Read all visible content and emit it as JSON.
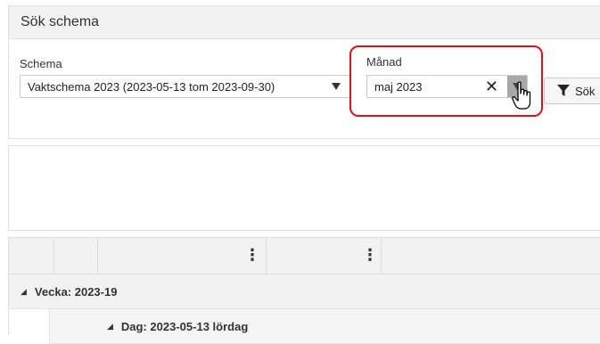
{
  "search_panel": {
    "title": "Sök schema",
    "schema": {
      "label": "Schema",
      "value": "Vaktschema 2023 (2023-05-13 tom 2023-09-30)"
    },
    "month": {
      "label": "Månad",
      "value": "maj 2023"
    },
    "filter_button": {
      "label": "Sök",
      "icon": "funnel-icon"
    }
  },
  "grid": {
    "column_menu_icon": "⋮",
    "groups": [
      {
        "label": "Vecka: 2023-19",
        "expanded": true,
        "level": 1
      },
      {
        "label": "Dag: 2023-05-13 lördag",
        "expanded": true,
        "level": 2
      }
    ]
  },
  "colors": {
    "highlight": "#d8141c",
    "header_bg": "#f2f2f2",
    "border": "#dedede"
  }
}
